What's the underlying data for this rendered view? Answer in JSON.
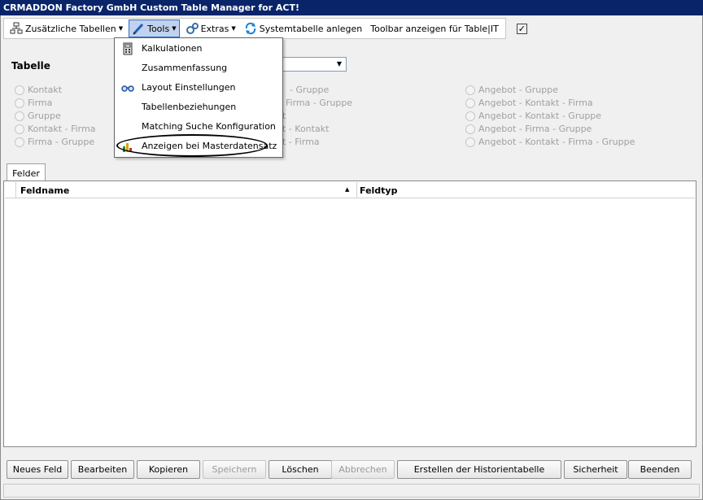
{
  "window": {
    "title": "CRMADDON Factory GmbH Custom Table Manager for ACT!"
  },
  "toolbar": {
    "items": [
      {
        "label": "Zusätzliche Tabellen",
        "icon": "tables-icon",
        "has_dropdown": true
      },
      {
        "label": "Tools",
        "icon": "pencil-icon",
        "has_dropdown": true,
        "active": true
      },
      {
        "label": "Extras",
        "icon": "gears-icon",
        "has_dropdown": true
      },
      {
        "label": "Systemtabelle anlegen",
        "icon": "refresh-icon",
        "has_dropdown": false
      },
      {
        "label": "Toolbar anzeigen für Table|IT",
        "icon": "",
        "has_dropdown": false
      }
    ],
    "toolbar_checkbox_checked": true
  },
  "tools_menu": {
    "items": [
      {
        "label": "Kalkulationen",
        "icon": "calculator-icon"
      },
      {
        "label": "Zusammenfassung",
        "icon": ""
      },
      {
        "label": "Layout Einstellungen",
        "icon": "glasses-icon"
      },
      {
        "label": "Tabellenbeziehungen",
        "icon": ""
      },
      {
        "label": "Matching Suche Konfiguration",
        "icon": ""
      },
      {
        "label": "Anzeigen bei Masterdatensatz",
        "icon": "chart-icon",
        "highlighted_by_ellipse": true
      }
    ]
  },
  "tabelle": {
    "label": "Tabelle",
    "combo_value": "",
    "radio_columns": [
      [
        "Kontakt",
        "Firma",
        "Gruppe",
        "Kontakt - Firma",
        "Firma - Gruppe"
      ],
      [
        "- Gruppe",
        ", Firma - Gruppe",
        "t",
        "t - Kontakt",
        "t - Firma"
      ],
      [
        "Angebot - Gruppe",
        "Angebot - Kontakt - Firma",
        "Angebot - Kontakt - Gruppe",
        "Angebot - Firma - Gruppe",
        "Angebot - Kontakt - Firma - Gruppe"
      ]
    ]
  },
  "tabs": [
    {
      "label": "Felder"
    }
  ],
  "grid": {
    "columns": [
      {
        "label": "Feldname",
        "sorted": "ascending"
      },
      {
        "label": "Feldtyp"
      }
    ],
    "rows": []
  },
  "buttons": [
    {
      "label": "Neues Feld",
      "enabled": true
    },
    {
      "label": "Bearbeiten",
      "enabled": true
    },
    {
      "label": "Kopieren",
      "enabled": true
    },
    {
      "label": "Speichern",
      "enabled": false
    },
    {
      "label": "Löschen",
      "enabled": true
    },
    {
      "label": "Abbrechen",
      "enabled": false
    },
    {
      "label": "Erstellen der Historientabelle",
      "enabled": true
    },
    {
      "label": "Sicherheit",
      "enabled": true
    },
    {
      "label": "Beenden",
      "enabled": true
    }
  ],
  "colors": {
    "titlebar": "#0a246a",
    "menu_highlight": "#c1d2ee",
    "disabled_text": "#a0a0a0"
  }
}
